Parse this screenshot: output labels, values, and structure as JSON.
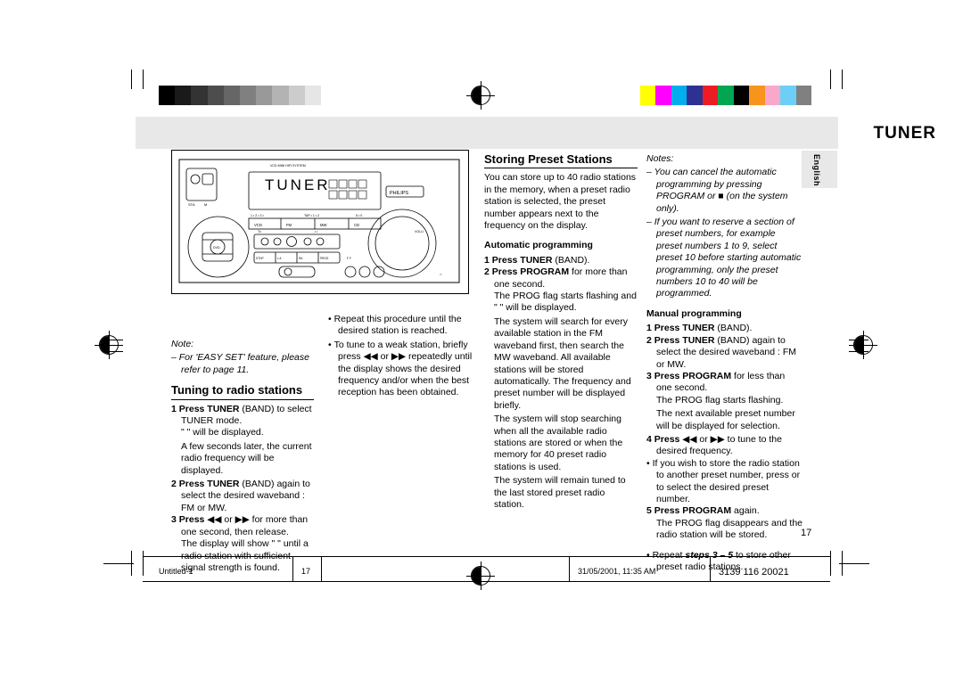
{
  "header": {
    "title": "TUNER",
    "side_tab": "English"
  },
  "colorbars": {
    "grey": [
      "#000000",
      "#1a1a1a",
      "#333333",
      "#4d4d4d",
      "#666666",
      "#808080",
      "#999999",
      "#b3b3b3",
      "#cccccc",
      "#e6e6e6",
      "#ffffff"
    ],
    "color": [
      "#ffffff",
      "#ffff00",
      "#ff00ff",
      "#00aeef",
      "#2e3192",
      "#ed1c24",
      "#00a651",
      "#000000",
      "#f7941e",
      "#f9a8c9",
      "#6dcff6",
      "#808080"
    ]
  },
  "illustration": {
    "brand": "PHILIPS",
    "display_text": "TUNER",
    "label_top": "VCD MINI HIFI SYSTEM",
    "row_labels_left": [
      "1",
      "2",
      "3",
      "4"
    ],
    "row_labels_mid": [
      "TAP",
      "1",
      "2"
    ],
    "row_labels_right": [
      "5",
      "0"
    ],
    "band_labels": [
      "FM",
      "MW"
    ],
    "clock_label": "CD",
    "buttons": [
      "STOP",
      "L A",
      "RA",
      "PROG",
      "F",
      "F"
    ],
    "tuner_knob_label": "VOLU"
  },
  "column1": {
    "note_label": "Note:",
    "note_text": "– For 'EASY SET' feature, please refer to page 11.",
    "heading": "Tuning to radio stations",
    "steps": [
      {
        "num": "1",
        "lead_bold": "Press TUNER",
        "lead_rest": " (BAND) to select TUNER mode.",
        "detail": [
          "\" \" will be displayed.",
          "A few seconds later, the current radio frequency will be displayed."
        ]
      },
      {
        "num": "2",
        "lead_bold": "Press TUNER",
        "lead_rest": " (BAND) again to select the desired waveband : FM or MW.",
        "detail": []
      },
      {
        "num": "3",
        "lead_bold": "Press",
        "lead_rest": " ◀◀ or ▶▶ for more than one second, then release.",
        "detail": [
          "The display will show \"                    \" until a radio station with sufficient signal strength is found."
        ]
      }
    ]
  },
  "column2": {
    "bullets": [
      "Repeat this procedure until the desired station is reached.",
      "To tune to a weak station, briefly press ◀◀ or ▶▶ repeatedly until the display shows the desired frequency and/or when the best reception has been obtained."
    ]
  },
  "column3": {
    "heading": "Storing Preset Stations",
    "intro": "You can store up to 40 radio stations in the memory, when a preset radio station is selected, the preset number appears next to the frequency on the display.",
    "sub_heading": "Automatic programming",
    "steps": [
      {
        "num": "1",
        "lead_bold": "Press TUNER",
        "lead_rest": " (BAND).",
        "detail": []
      },
      {
        "num": "2",
        "lead_bold": "Press PROGRAM",
        "lead_rest": " for more than one second.",
        "detail": [
          "The PROG flag starts flashing and \"           \" will be displayed.",
          "The system will search for every available station in the FM waveband first, then search the MW waveband. All available stations will be stored automatically. The frequency and preset number will be displayed briefly.",
          "The system  will stop searching when all the available radio stations are stored or when the memory for 40 preset radio stations is used.",
          "The system will remain tuned to the last stored preset radio station."
        ]
      }
    ]
  },
  "column4": {
    "notes_label": "Notes:",
    "notes": [
      "– You can cancel the automatic programming by pressing PROGRAM or ■ (on the system only).",
      "– If you want to reserve a section of preset numbers, for example preset numbers 1 to 9, select preset 10 before starting automatic programming, only the preset numbers 10 to 40 will be programmed."
    ],
    "sub_heading": "Manual programming",
    "steps": [
      {
        "num": "1",
        "lead_bold": "Press TUNER",
        "lead_rest": " (BAND).",
        "detail": []
      },
      {
        "num": "2",
        "lead_bold": "Press TUNER",
        "lead_rest": " (BAND) again to select the desired waveband : FM or MW.",
        "detail": []
      },
      {
        "num": "3",
        "lead_bold": "Press PROGRAM",
        "lead_rest": " for less than one second.",
        "detail": [
          "The PROG flag starts flashing.",
          "The next available preset number will be displayed for selection."
        ]
      },
      {
        "num": "4",
        "lead_bold": "Press",
        "lead_rest": " ◀◀ or ▶▶ to tune to the desired frequency.",
        "detail": []
      },
      {
        "num": "•",
        "lead_bold": "",
        "lead_rest": "If you wish to store the radio station to another preset number, press    or    to select the desired preset number.",
        "detail": []
      },
      {
        "num": "5",
        "lead_bold": "Press PROGRAM",
        "lead_rest": " again.",
        "detail": [
          "The PROG flag disappears and the radio station will be stored."
        ]
      }
    ],
    "final_bullet_pre": "• Repeat ",
    "final_bullet_em": "steps 3 – 5",
    "final_bullet_post": " to store other preset radio stations."
  },
  "footer": {
    "file": "Untitled-1",
    "page": "17",
    "date": "31/05/2001, 11:35 AM",
    "code": "3139 116 20021",
    "page_number": "17"
  }
}
